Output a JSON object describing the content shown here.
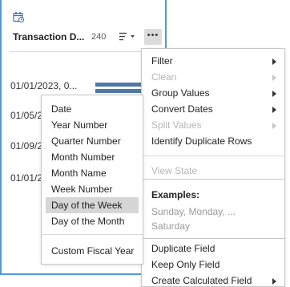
{
  "card": {
    "title": "Transaction D...",
    "count": "240",
    "more_label": "•••",
    "rows": [
      {
        "label": "01/01/2023, 0..."
      },
      {
        "label": "01/05/2"
      },
      {
        "label": "01/09/2"
      },
      {
        "label": "01/01/2"
      }
    ]
  },
  "menu": {
    "filter": "Filter",
    "clean": "Clean",
    "group_values": "Group Values",
    "convert_dates": "Convert Dates",
    "split_values": "Split Values",
    "identify_duplicate_rows": "Identify Duplicate Rows",
    "view_state": "View State",
    "duplicate_field": "Duplicate Field",
    "keep_only_field": "Keep Only Field",
    "create_calculated_field": "Create Calculated Field"
  },
  "examples": {
    "title": "Examples:",
    "line1": "Sunday, Monday, ...",
    "line2": "Saturday"
  },
  "submenu": {
    "items": [
      {
        "label": "Date"
      },
      {
        "label": "Year Number"
      },
      {
        "label": "Quarter Number"
      },
      {
        "label": "Month Number"
      },
      {
        "label": "Month Name"
      },
      {
        "label": "Week Number"
      },
      {
        "label": "Day of the Week"
      },
      {
        "label": "Day of the Month"
      },
      {
        "label": "Custom Fiscal Year"
      }
    ],
    "selected": "Day of the Week"
  },
  "colors": {
    "card_border": "#4d9bd7",
    "bar": "#4e79a7",
    "selected_bg": "#d6d6d6",
    "disabled_text": "#b5b5b5"
  }
}
